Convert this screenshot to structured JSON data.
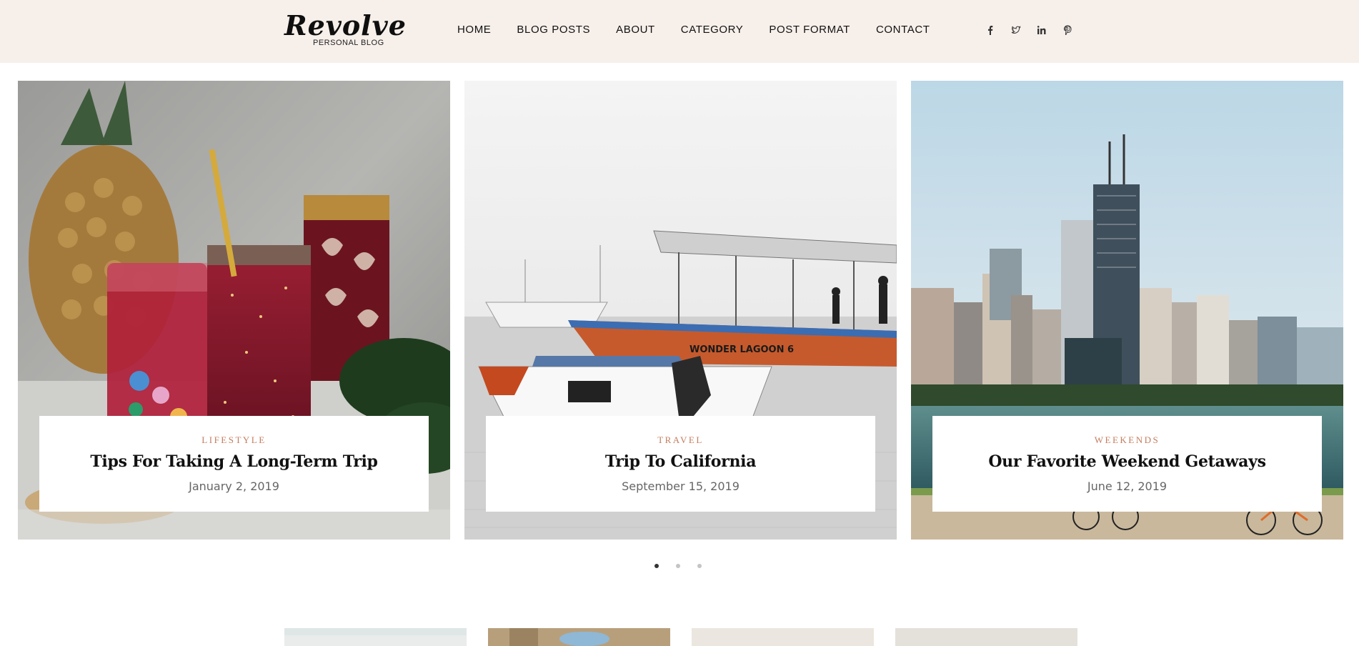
{
  "header": {
    "logo_main": "Revolve",
    "logo_sub": "PERSONAL BLOG",
    "nav": [
      "HOME",
      "BLOG POSTS",
      "ABOUT",
      "CATEGORY",
      "POST FORMAT",
      "CONTACT"
    ],
    "social_icons": [
      "facebook-icon",
      "twitter-icon",
      "linkedin-icon",
      "pinterest-icon"
    ]
  },
  "slides": [
    {
      "category": "LIFESTYLE",
      "title": "Tips For Taking A Long-Term Trip",
      "date": "January 2, 2019"
    },
    {
      "category": "TRAVEL",
      "title": "Trip To California",
      "date": "September 15, 2019"
    },
    {
      "category": "WEEKENDS",
      "title": "Our Favorite Weekend Getaways",
      "date": "June 12, 2019"
    }
  ],
  "slider_dots": {
    "count": 3,
    "active": 1
  },
  "colors": {
    "header_bg": "#f7efea",
    "accent": "#c47d5e"
  }
}
